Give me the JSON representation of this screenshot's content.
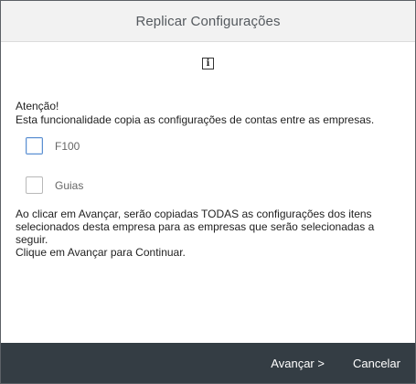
{
  "dialog": {
    "title": "Replicar Configurações",
    "info_icon": "info-icon",
    "attention": "Atenção!",
    "description": "Esta funcionalidade copia as configurações de contas entre as empresas.",
    "options": [
      {
        "label": "F100",
        "checked": false
      },
      {
        "label": "Guias",
        "checked": false
      }
    ],
    "notice_line1": "Ao clicar em Avançar, serão copiadas TODAS as configurações dos itens selecionados desta empresa para as empresas que serão selecionadas a seguir.",
    "notice_line2": "Clique em Avançar para Continuar."
  },
  "footer": {
    "next_label": "Avançar >",
    "cancel_label": "Cancelar"
  },
  "colors": {
    "header_bg": "#f2f2f2",
    "footer_bg": "#343d44",
    "focus_border": "#5b8fd1"
  }
}
